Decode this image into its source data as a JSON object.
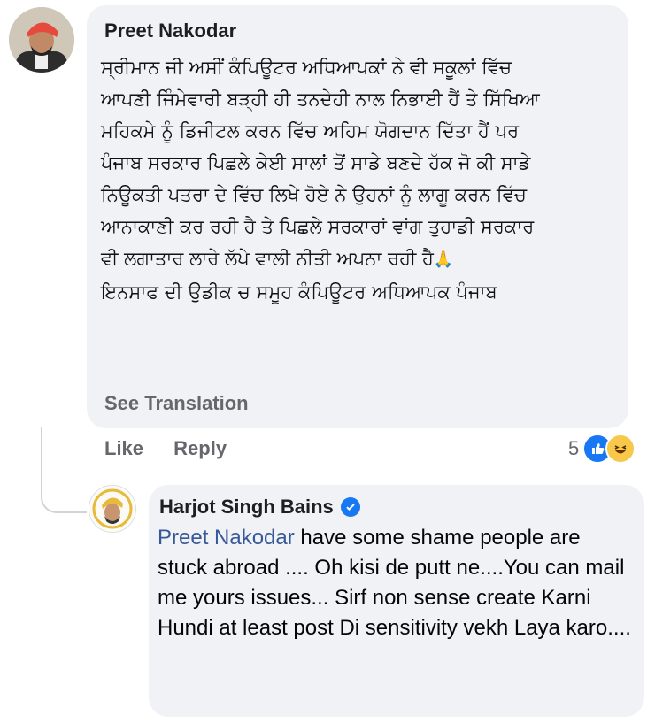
{
  "comment": {
    "author": "Preet Nakodar",
    "lines": [
      "ਸ੍ਰੀਮਾਨ ਜੀ ਅਸੀਂ ਕੰਪਿਊਟਰ ਅਧਿਆਪਕਾਂ ਨੇ ਵੀ ਸਕੂਲਾਂ ਵਿੱਚ",
      "ਆਪਣੀ ਜਿੰਮੇਵਾਰੀ ਬੜ੍ਹੀ ਹੀ ਤਨਦੇਹੀ ਨਾਲ ਨਿਭਾਈ ਹੈਂ ਤੇ ਸਿੱਖਿਆ",
      "ਮਹਿਕਮੇ ਨੂੰ ਡਿਜੀਟਲ ਕਰਨ ਵਿੱਚ ਅਹਿਮ ਯੋਗਦਾਨ ਦਿੱਤਾ ਹੈਂ ਪਰ",
      "ਪੰਜਾਬ ਸਰਕਾਰ ਪਿਛਲੇ ਕੇਈ ਸਾਲਾਂ ਤੋਂ ਸਾਡੇ ਬਣਦੇ ਹੱਕ ਜੋ ਕੀ ਸਾਡੇ",
      "ਨਿਊਕਤੀ ਪਤਰਾ ਦੇ ਵਿੱਚ ਲਿਖੇ ਹੋਏ ਨੇ ਉਹਨਾਂ ਨੂੰ ਲਾਗੂ ਕਰਨ ਵਿੱਚ",
      "ਆਨਾਕਾਣੀ ਕਰ ਰਹੀ ਹੈ ਤੇ ਪਿਛਲੇ ਸਰਕਾਰਾਂ ਵਾਂਗ ਤੁਹਾਡੀ ਸਰਕਾਰ",
      "ਵੀ ਲਗਾਤਾਰ ਲਾਰੇ ਲੱਪੇ ਵਾਲੀ ਨੀਤੀ ਅਪਨਾ ਰਹੀ ਹੈ",
      "ਇਨਸਾਫ ਦੀ ਉਡੀਕ ਚ ਸਮੂਹ ਕੰਪਿਊਟਰ ਅਧਿਆਪਕ ਪੰਜਾਬ"
    ],
    "see_translation": "See Translation",
    "like_label": "Like",
    "reply_label": "Reply",
    "reaction_count": "5"
  },
  "reply": {
    "author": "Harjot Singh Bains",
    "mention": "Preet Nakodar",
    "text": " have some shame people are stuck abroad .... Oh kisi de putt ne....You can mail me yours issues... Sirf non sense create Karni Hundi at least post Di sensitivity vekh Laya karo...."
  },
  "colors": {
    "bubble": "#f0f2f5",
    "link": "#385898",
    "secondary_text": "#65676b",
    "verified": "#1877f2"
  },
  "icons": [
    "avatar-preet",
    "folded-hands-emoji",
    "like-reaction-icon",
    "haha-reaction-icon",
    "verified-badge-icon",
    "avatar-harjot"
  ]
}
